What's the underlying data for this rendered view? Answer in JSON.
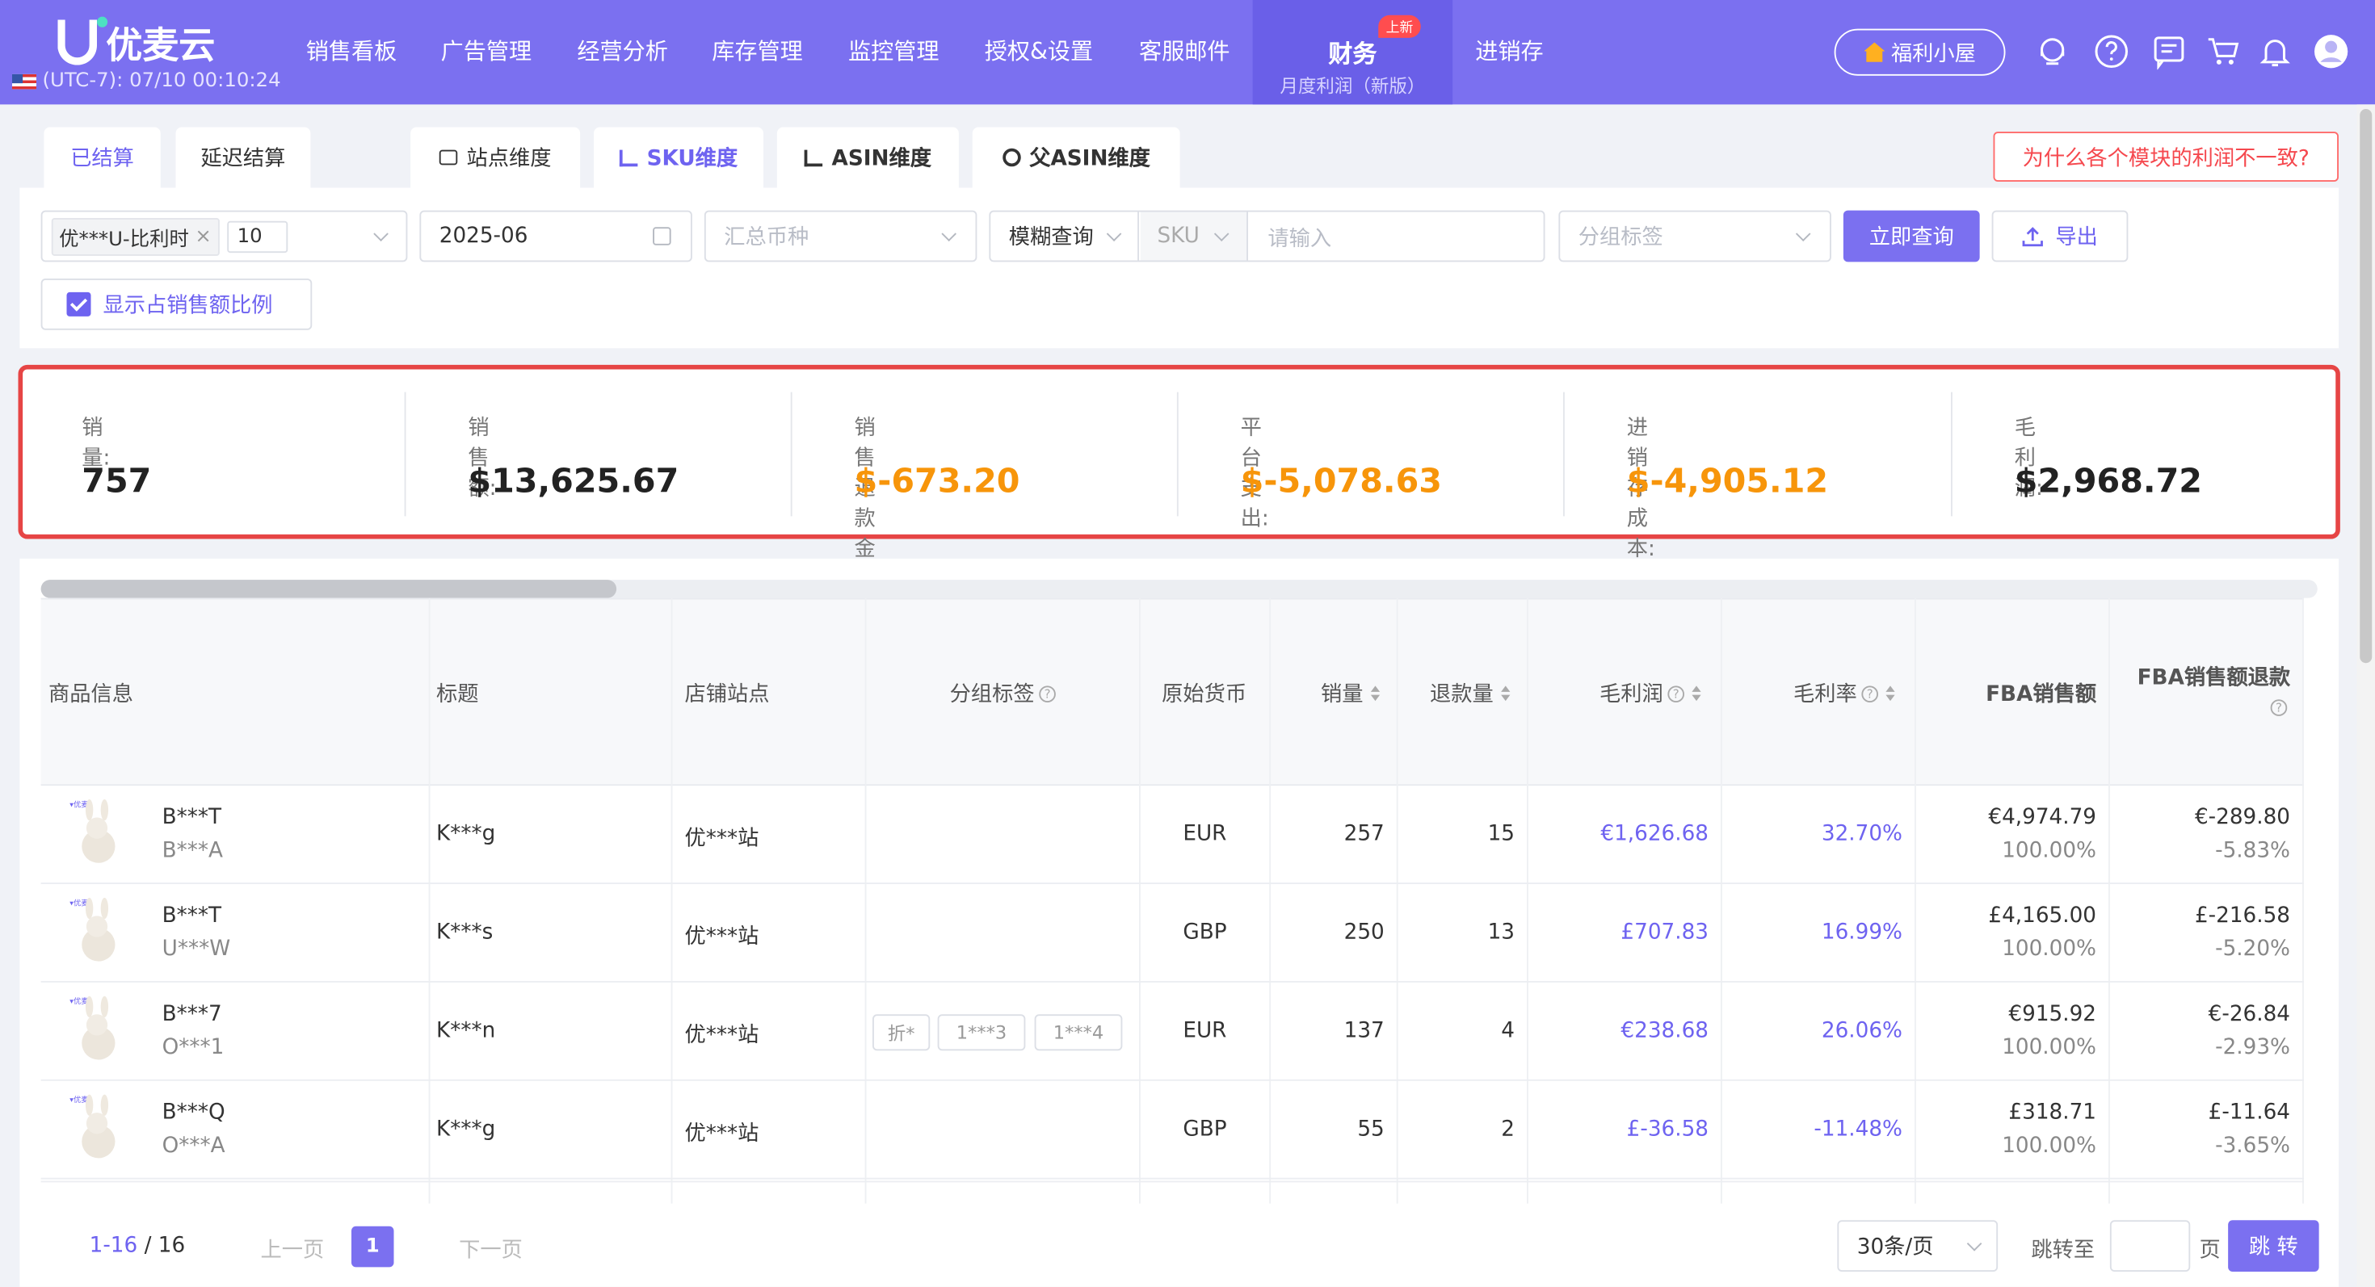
{
  "app": {
    "logo_text": "优麦云",
    "timezone": "(UTC-7): 07/10 00:10:24"
  },
  "nav": {
    "items": [
      "销售看板",
      "广告管理",
      "经营分析",
      "库存管理",
      "监控管理",
      "授权&设置",
      "客服邮件"
    ],
    "active": {
      "label": "财务",
      "sub": "月度利润（新版）",
      "badge": "上新"
    },
    "after": "进销存",
    "welfare": "福利小屋",
    "icons": [
      "headset-icon",
      "help-icon",
      "message-icon",
      "cart-icon",
      "bell-icon",
      "user-avatar-icon"
    ]
  },
  "tabs": {
    "settled": "已结算",
    "delayed": "延迟结算"
  },
  "dims": {
    "site": "站点维度",
    "sku": "SKU维度",
    "asin": "ASIN维度",
    "parent_asin": "父ASIN维度",
    "active": "SKU维度"
  },
  "why_button": "为什么各个模块的利润不一致?",
  "filter": {
    "shop_tag": "优***U-比利时",
    "shop_count": "10",
    "month": "2025-06",
    "currency_placeholder": "汇总币种",
    "match_mode": "模糊查询",
    "field": "SKU",
    "keyword_placeholder": "请输入",
    "group_placeholder": "分组标签",
    "query_button": "立即查询",
    "export_button": "导出",
    "show_ratio": "显示占销售额比例",
    "show_ratio_checked": true
  },
  "summary": [
    {
      "label": "销量:",
      "value": "757",
      "negative": false
    },
    {
      "label": "销售额:",
      "value": "$13,625.67",
      "negative": false
    },
    {
      "label": "销售退款金额:",
      "value": "$-673.20",
      "negative": true
    },
    {
      "label": "平台支出:",
      "value": "$-5,078.63",
      "negative": true
    },
    {
      "label": "进销存成本:",
      "value": "$-4,905.12",
      "negative": true
    },
    {
      "label": "毛利润:",
      "value": "$2,968.72",
      "negative": false
    }
  ],
  "table": {
    "headers": {
      "product": "商品信息",
      "title": "标题",
      "store": "店铺站点",
      "group": "分组标签",
      "currency": "原始货币",
      "qty": "销量",
      "refund_qty": "退款量",
      "gross_profit": "毛利润",
      "margin": "毛利率",
      "fba_sales": "FBA销售额",
      "fba_refund": "FBA销售额退款"
    },
    "rows": [
      {
        "sku": "B***T",
        "asin": "B***A",
        "title": "K***g",
        "store": "优***站",
        "tags": [],
        "currency": "EUR",
        "qty": "257",
        "refund": "15",
        "profit": "€1,626.68",
        "margin": "32.70%",
        "fba": "€4,974.79",
        "fba_pct": "100.00%",
        "fba_refund": "€-289.80",
        "fba_refund_pct": "-5.83%"
      },
      {
        "sku": "B***T",
        "asin": "U***W",
        "title": "K***s",
        "store": "优***站",
        "tags": [],
        "currency": "GBP",
        "qty": "250",
        "refund": "13",
        "profit": "£707.83",
        "margin": "16.99%",
        "fba": "£4,165.00",
        "fba_pct": "100.00%",
        "fba_refund": "£-216.58",
        "fba_refund_pct": "-5.20%"
      },
      {
        "sku": "B***7",
        "asin": "O***1",
        "title": "K***n",
        "store": "优***站",
        "tags": [
          "折*",
          "1***3",
          "1***4"
        ],
        "currency": "EUR",
        "qty": "137",
        "refund": "4",
        "profit": "€238.68",
        "margin": "26.06%",
        "fba": "€915.92",
        "fba_pct": "100.00%",
        "fba_refund": "€-26.84",
        "fba_refund_pct": "-2.93%"
      },
      {
        "sku": "B***Q",
        "asin": "O***A",
        "title": "K***g",
        "store": "优***站",
        "tags": [],
        "currency": "GBP",
        "qty": "55",
        "refund": "2",
        "profit": "£-36.58",
        "margin": "-11.48%",
        "fba": "£318.71",
        "fba_pct": "100.00%",
        "fba_refund": "£-11.64",
        "fba_refund_pct": "-3.65%"
      }
    ]
  },
  "pager": {
    "range": "1-16",
    "sep": "/",
    "total": "16",
    "prev": "上一页",
    "current": "1",
    "next": "下一页",
    "page_size": "30条/页",
    "jump_label": "跳转至",
    "page_unit": "页",
    "jump_button": "跳 转"
  },
  "colors": {
    "brand": "#7b70f0",
    "accent": "#6e63f0",
    "negative": "#f7950a",
    "highlight_border": "#e64545"
  }
}
